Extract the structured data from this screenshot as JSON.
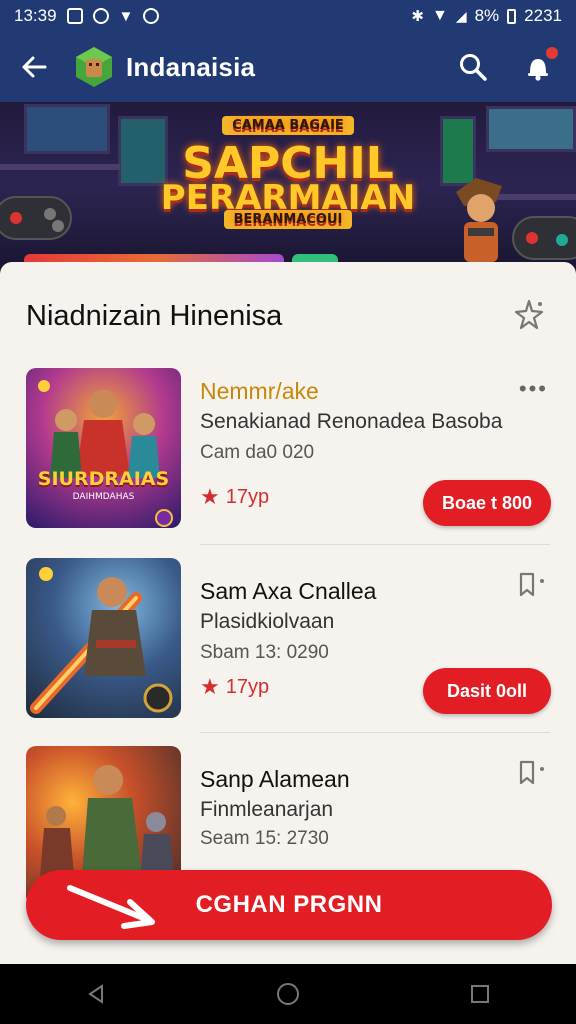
{
  "status": {
    "time": "13:39",
    "battery": "8%",
    "right_time": "2231"
  },
  "appbar": {
    "title": "Indanaisia"
  },
  "banner": {
    "top_tag": "CAMAA BAGAIE",
    "title_line1": "SAPCHIL",
    "title_line2": "PERARMAIAN",
    "sub_tag": "BERANMACOUI"
  },
  "section": {
    "title": "Niadnizain Hinenisa"
  },
  "items": [
    {
      "title": "Nemmr/ake",
      "subtitle": "Senakianad Renonadea Basoba",
      "meta": "Cam da0 020",
      "rating": "17yp",
      "button_label": "Boae t 800",
      "thumb_text": "SIURDRAIAS",
      "thumb_subtext": "DAIHMDAHAS"
    },
    {
      "title": "Sam Axa Cnallea",
      "subtitle": "Plasidkiolvaan",
      "meta": "Sbam 13: 0290",
      "rating": "17yp",
      "button_label": "Dasit 0oll"
    },
    {
      "title": "Sanp Alamean",
      "subtitle": "Finmleanarjan",
      "meta": "Seam 15: 2730"
    }
  ],
  "cta": {
    "label": "CGHAN PRGNN"
  },
  "colors": {
    "primary_bar": "#223a73",
    "accent_red": "#e31d24",
    "panel_bg": "#f6f3ef"
  }
}
